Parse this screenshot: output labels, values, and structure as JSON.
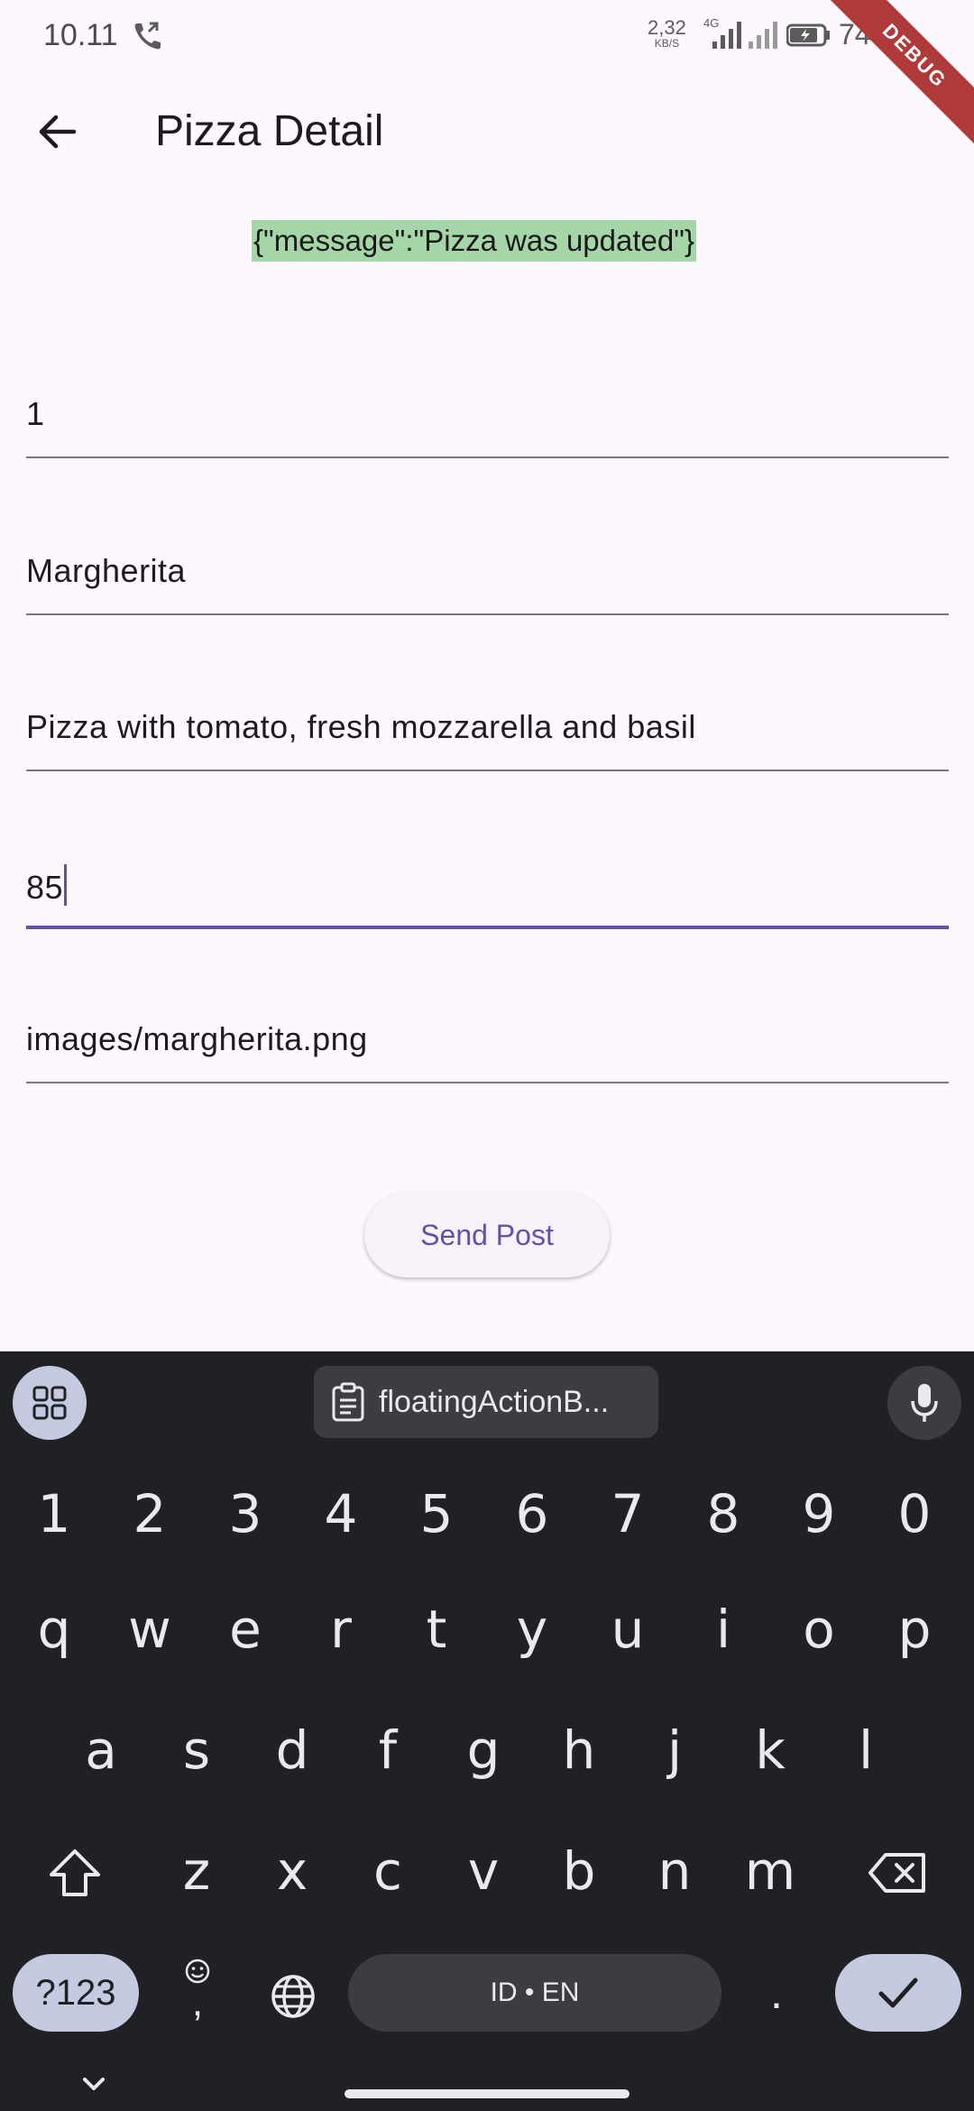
{
  "status_bar": {
    "time": "10.11",
    "net_speed_value": "2,32",
    "net_speed_unit": "KB/S",
    "network_type": "4G",
    "battery_percent": "74%",
    "debug_banner": "DEBUG"
  },
  "app_bar": {
    "title": "Pizza Detail",
    "back_icon": "arrow-back-icon"
  },
  "message": "{\"message\":\"Pizza was updated\"}",
  "form": {
    "fields": [
      {
        "name": "id",
        "value": "1"
      },
      {
        "name": "pizza_name",
        "value": "Margherita"
      },
      {
        "name": "description",
        "value": "Pizza with tomato, fresh mozzarella and basil"
      },
      {
        "name": "price",
        "value": "85",
        "focused": true
      },
      {
        "name": "image_url",
        "value": "images/margherita.png"
      }
    ],
    "submit_label": "Send Post"
  },
  "keyboard": {
    "clipboard_suggestion": "floatingActionB...",
    "row_numbers": [
      "1",
      "2",
      "3",
      "4",
      "5",
      "6",
      "7",
      "8",
      "9",
      "0"
    ],
    "row_1": [
      "q",
      "w",
      "e",
      "r",
      "t",
      "y",
      "u",
      "i",
      "o",
      "p"
    ],
    "row_2": [
      "a",
      "s",
      "d",
      "f",
      "g",
      "h",
      "j",
      "k",
      "l"
    ],
    "row_3": [
      "z",
      "x",
      "c",
      "v",
      "b",
      "n",
      "m"
    ],
    "symbols_label": "?123",
    "emoji_comma_label": ",",
    "space_label": "ID • EN",
    "period_label": ".",
    "icons": [
      "apps-grid-icon",
      "clipboard-icon",
      "mic-icon",
      "shift-icon",
      "backspace-icon",
      "emoji-icon",
      "globe-icon",
      "check-icon",
      "chevron-down-icon"
    ]
  },
  "colors": {
    "background": "#fdf7fe",
    "accent": "#6750a4",
    "message_bg": "#a5d6a7",
    "keyboard_bg": "#202124",
    "debug_ribbon": "#b03a3a"
  }
}
